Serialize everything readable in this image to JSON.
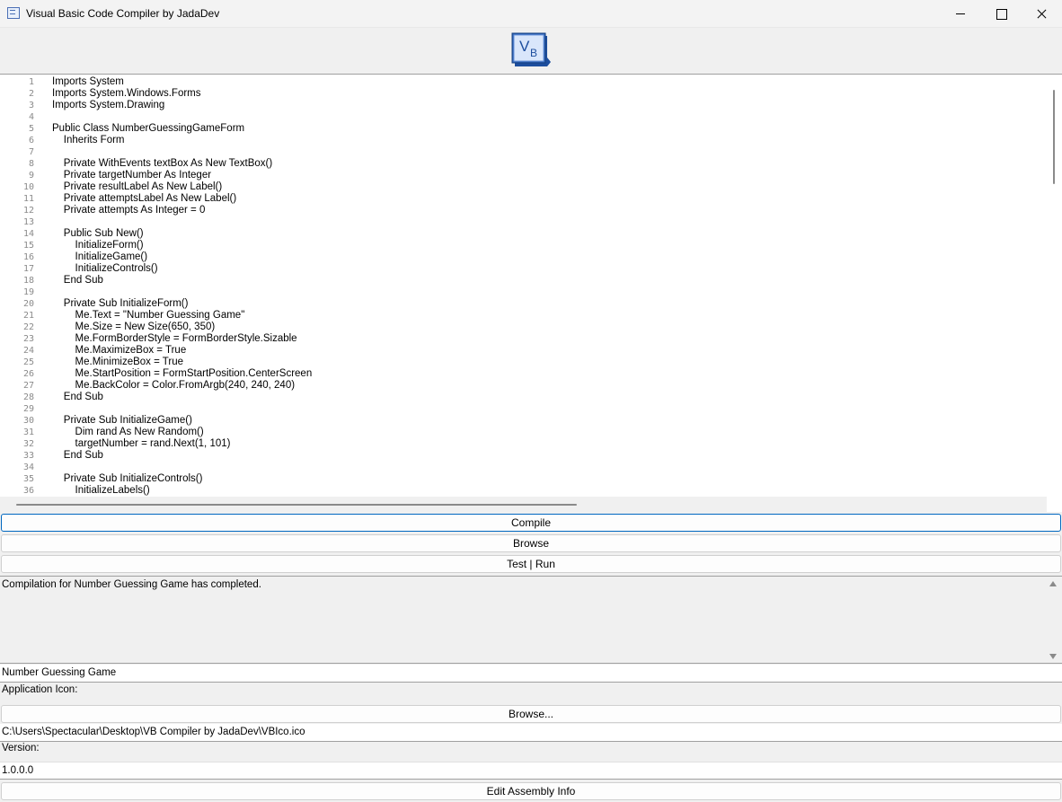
{
  "window": {
    "title": "Visual Basic Code Compiler by JadaDev"
  },
  "logo": {
    "text_v": "V",
    "text_b": "B"
  },
  "editor": {
    "line_numbers": [
      "1",
      "2",
      "3",
      "4",
      "5",
      "6",
      "7",
      "8",
      "9",
      "10",
      "11",
      "12",
      "13",
      "14",
      "15",
      "16",
      "17",
      "18",
      "19",
      "20",
      "21",
      "22",
      "23",
      "24",
      "25",
      "26",
      "27",
      "28",
      "29",
      "30",
      "31",
      "32",
      "33",
      "34",
      "35",
      "36"
    ],
    "lines": [
      "Imports System",
      "Imports System.Windows.Forms",
      "Imports System.Drawing",
      "",
      "Public Class NumberGuessingGameForm",
      "    Inherits Form",
      "",
      "    Private WithEvents textBox As New TextBox()",
      "    Private targetNumber As Integer",
      "    Private resultLabel As New Label()",
      "    Private attemptsLabel As New Label()",
      "    Private attempts As Integer = 0",
      "",
      "    Public Sub New()",
      "        InitializeForm()",
      "        InitializeGame()",
      "        InitializeControls()",
      "    End Sub",
      "",
      "    Private Sub InitializeForm()",
      "        Me.Text = \"Number Guessing Game\"",
      "        Me.Size = New Size(650, 350)",
      "        Me.FormBorderStyle = FormBorderStyle.Sizable",
      "        Me.MaximizeBox = True",
      "        Me.MinimizeBox = True",
      "        Me.StartPosition = FormStartPosition.CenterScreen",
      "        Me.BackColor = Color.FromArgb(240, 240, 240)",
      "    End Sub",
      "",
      "    Private Sub InitializeGame()",
      "        Dim rand As New Random()",
      "        targetNumber = rand.Next(1, 101)",
      "    End Sub",
      "",
      "    Private Sub InitializeControls()",
      "        InitializeLabels()"
    ]
  },
  "buttons": {
    "compile": "Compile",
    "browse": "Browse",
    "test_run": "Test | Run",
    "icon_browse": "Browse...",
    "edit_assembly": "Edit Assembly Info"
  },
  "output": {
    "message": "Compilation for Number Guessing Game has completed."
  },
  "app_name": {
    "value": "Number Guessing Game"
  },
  "icon_section": {
    "label": "Application Icon:",
    "path": "C:\\Users\\Spectacular\\Desktop\\VB Compiler by JadaDev\\VBIco.ico"
  },
  "version_section": {
    "label": "Version:",
    "value": "1.0.0.0"
  },
  "colors": {
    "accent": "#0067c0",
    "logo_blue": "#2f63b8"
  }
}
